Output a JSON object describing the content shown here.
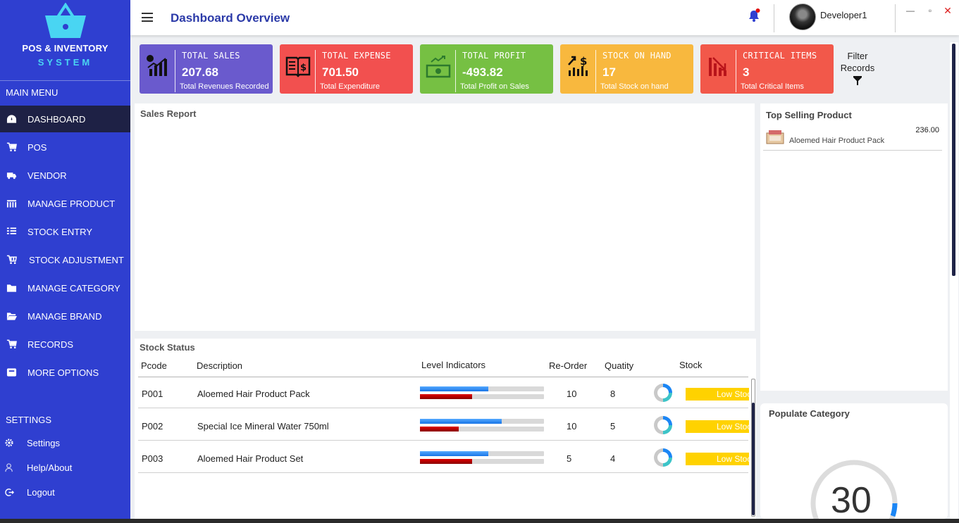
{
  "app": {
    "title": "POS & INVENTORY",
    "subtitle": "SYSTEM"
  },
  "sidebar": {
    "main_menu_label": "MAIN MENU",
    "items": [
      {
        "label": "DASHBOARD",
        "icon": "dashboard-icon",
        "active": true
      },
      {
        "label": "POS",
        "icon": "cart-icon"
      },
      {
        "label": "VENDOR",
        "icon": "truck-icon"
      },
      {
        "label": "MANAGE PRODUCT",
        "icon": "barcode-icon"
      },
      {
        "label": "STOCK ENTRY",
        "icon": "list-icon"
      },
      {
        "label": "STOCK ADJUSTMENT",
        "icon": "cart-adjust-icon"
      },
      {
        "label": "MANAGE CATEGORY",
        "icon": "folder-icon"
      },
      {
        "label": "MANAGE BRAND",
        "icon": "folder-open-icon"
      },
      {
        "label": "RECORDS",
        "icon": "cart-icon"
      },
      {
        "label": "MORE OPTIONS",
        "icon": "options-icon"
      }
    ],
    "settings_label": "SETTINGS",
    "settings_items": [
      {
        "label": "Settings",
        "icon": "gear-icon"
      },
      {
        "label": "Help/About",
        "icon": "help-icon"
      },
      {
        "label": "Logout",
        "icon": "logout-icon"
      }
    ]
  },
  "header": {
    "title": "Dashboard Overview",
    "user_name": "Developer1",
    "notification_dot_color": "#e01010"
  },
  "cards": [
    {
      "label": "TOTAL SALES",
      "value": "207.68",
      "sub": "Total Revenues Recorded",
      "color": "#6a5acd",
      "icon": "bar-chart-icon"
    },
    {
      "label": "TOTAL EXPENSE",
      "value": "701.50",
      "sub": "Total Expenditure",
      "color": "#f2504f",
      "icon": "book-dollar-icon"
    },
    {
      "label": "TOTAL PROFIT",
      "value": "-493.82",
      "sub": "Total Profit on Sales",
      "color": "#76c043",
      "icon": "money-growth-icon"
    },
    {
      "label": "STOCK ON HAND",
      "value": "17",
      "sub": "Total Stock on hand",
      "color": "#f8b83e",
      "icon": "dollar-growth-icon"
    },
    {
      "label": "CRITICAL ITEMS",
      "value": "3",
      "sub": "Total Critical Items",
      "color": "#f2584a",
      "icon": "chart-down-icon"
    }
  ],
  "filter": {
    "label": "Filter Records"
  },
  "sales_report": {
    "title": "Sales Report"
  },
  "top_selling": {
    "title": "Top Selling Product",
    "items": [
      {
        "name": "Aloemed Hair Product Pack",
        "amount": "236.00"
      }
    ]
  },
  "populate_category": {
    "title": "Populate Category",
    "gauge_value": "30"
  },
  "stock_status": {
    "title": "Stock Status",
    "columns": [
      "Pcode",
      "Description",
      "Level Indicators",
      "Re-Order",
      "Quatity",
      "Stock"
    ],
    "rows": [
      {
        "pcode": "P001",
        "description": "Aloemed Hair Product Pack",
        "reorder": "10",
        "quantity": "8",
        "stock": "Low Stock",
        "blue_level": 0.55,
        "red_level": 0.42
      },
      {
        "pcode": "P002",
        "description": "Special Ice Mineral Water 750ml",
        "reorder": "10",
        "quantity": "5",
        "stock": "Low Stock",
        "blue_level": 0.66,
        "red_level": 0.31
      },
      {
        "pcode": "P003",
        "description": "Aloemed Hair Product Set",
        "reorder": "5",
        "quantity": "4",
        "stock": "Low Stock",
        "blue_level": 0.55,
        "red_level": 0.42
      }
    ]
  }
}
